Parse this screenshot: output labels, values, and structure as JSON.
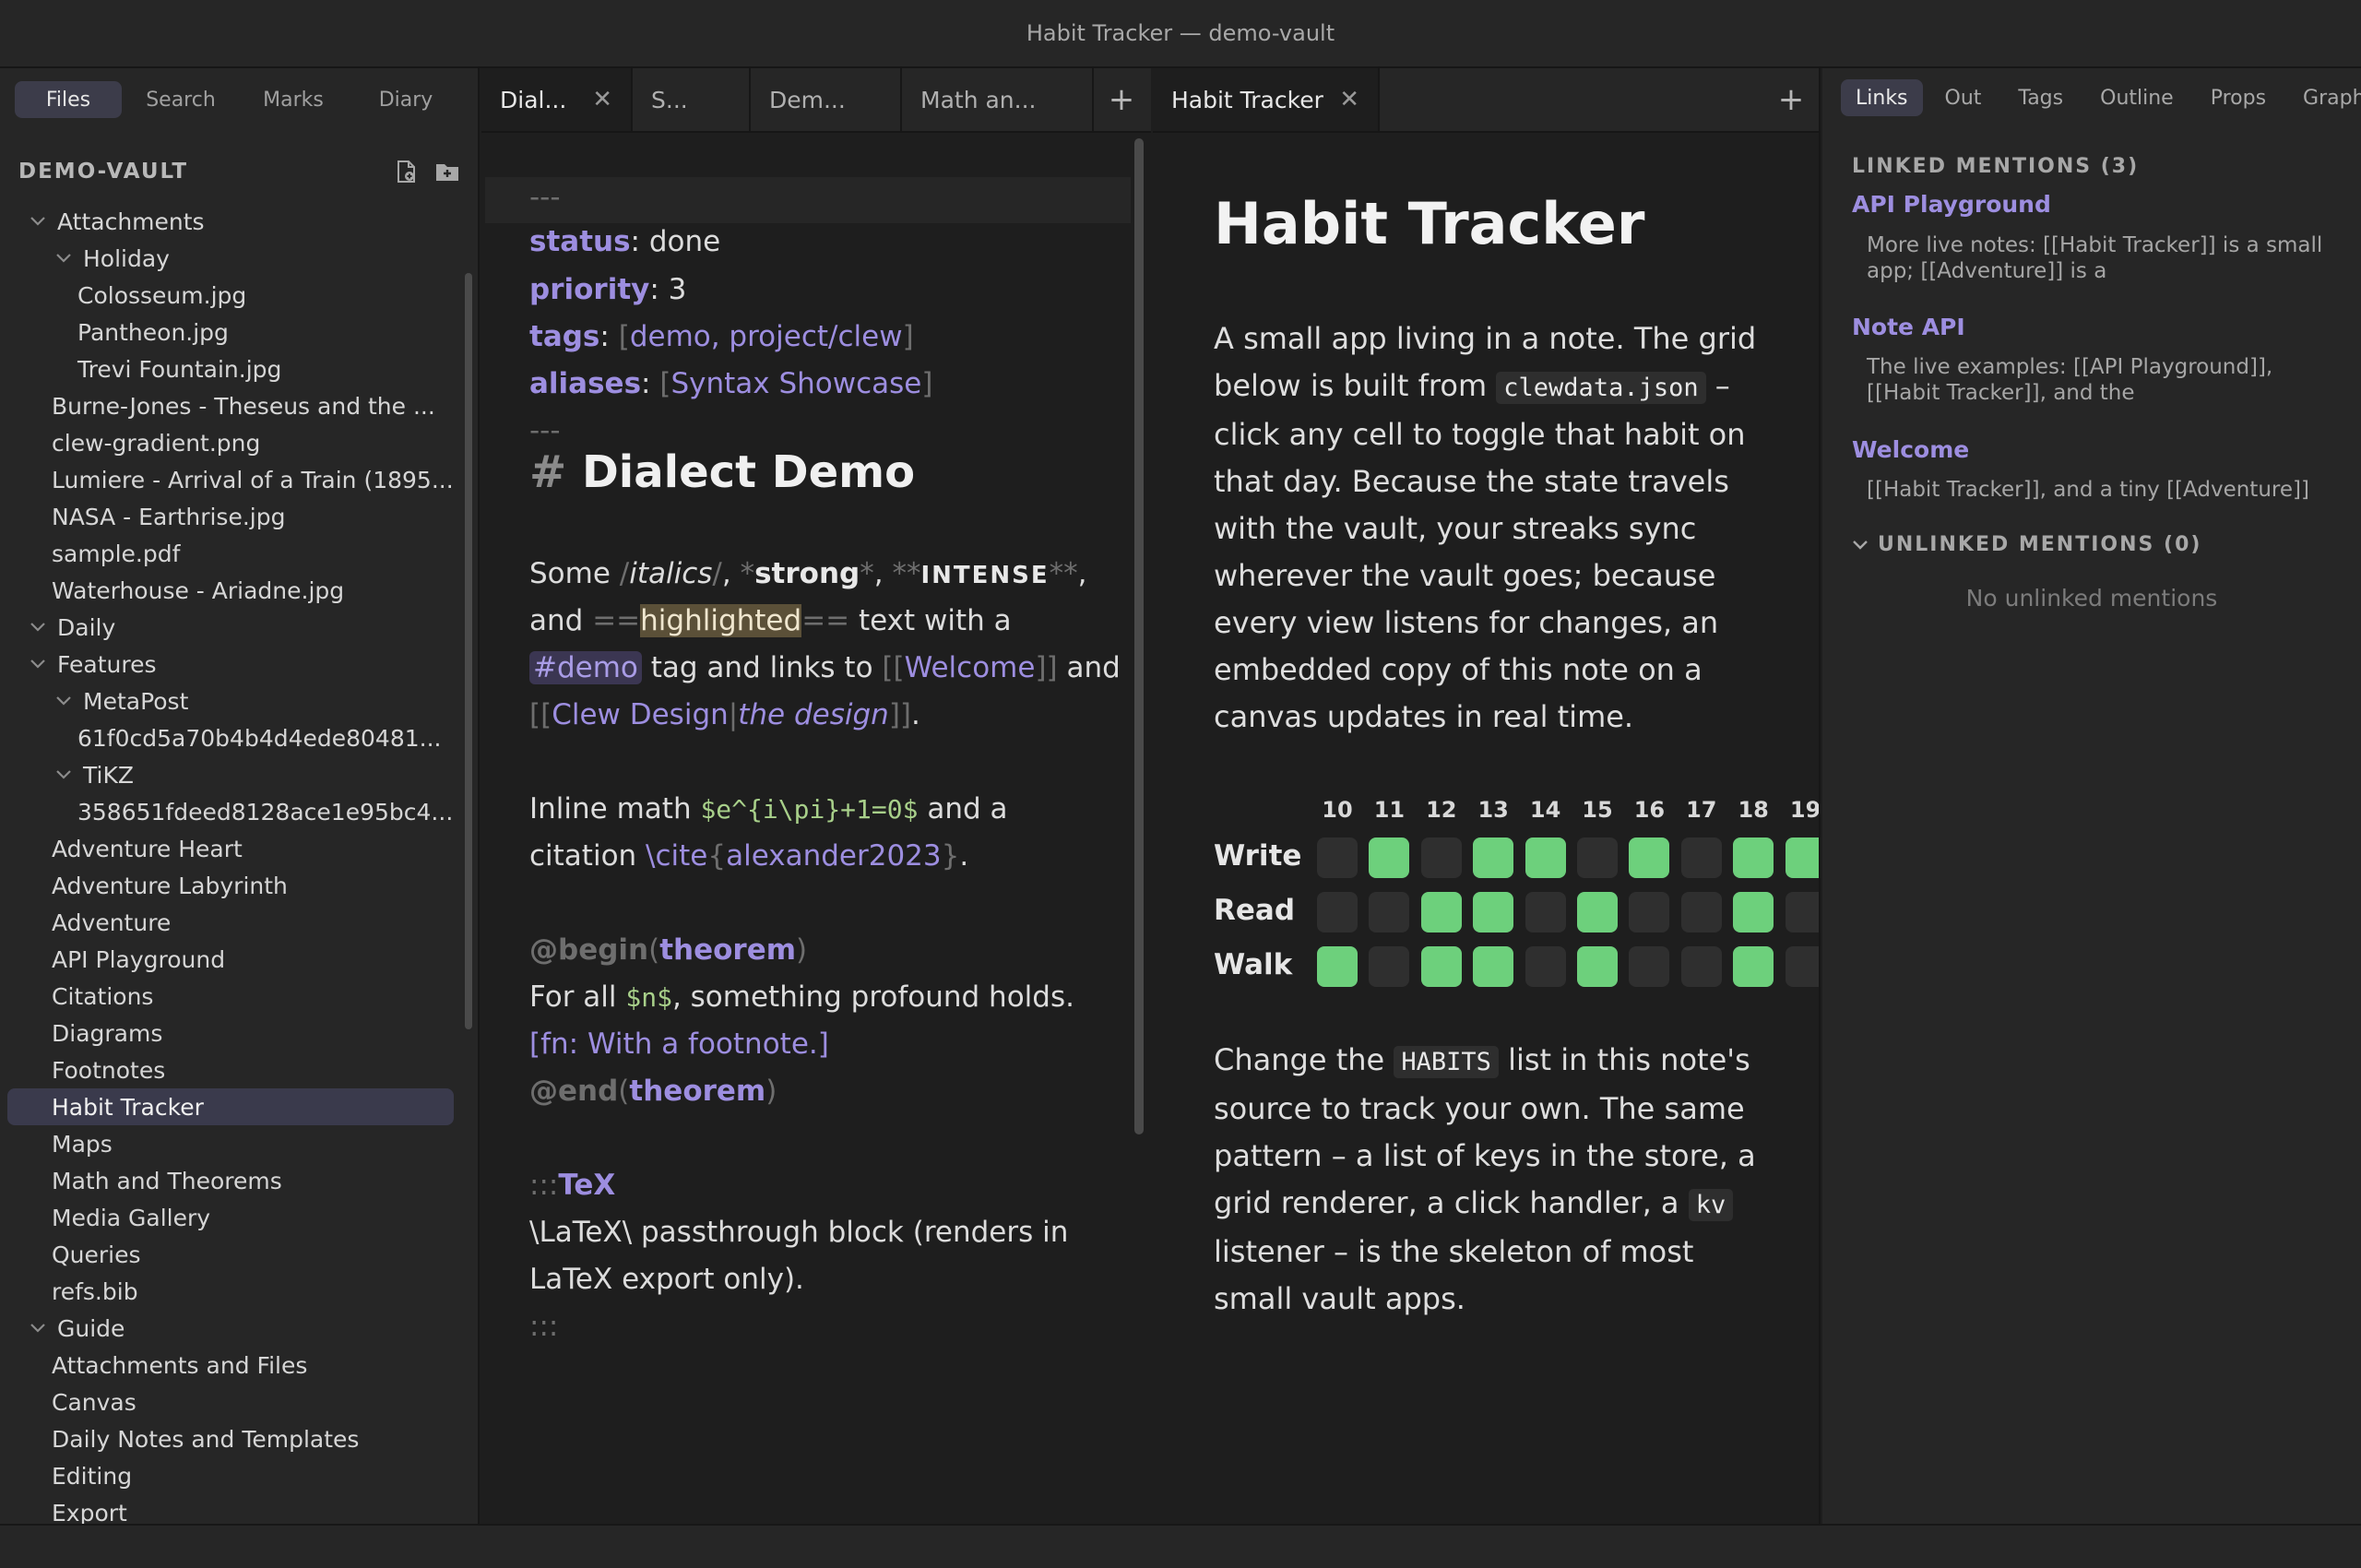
{
  "window": {
    "title": "Habit Tracker — demo-vault"
  },
  "sidebar": {
    "tabs": [
      "Files",
      "Search",
      "Marks",
      "Diary"
    ],
    "vault_name": "DEMO-VAULT",
    "tree": [
      {
        "label": "Attachments",
        "depth": 0,
        "folder": true
      },
      {
        "label": "Holiday",
        "depth": 1,
        "folder": true
      },
      {
        "label": "Colosseum.jpg",
        "depth": 2
      },
      {
        "label": "Pantheon.jpg",
        "depth": 2
      },
      {
        "label": "Trevi Fountain.jpg",
        "depth": 2
      },
      {
        "label": "Burne-Jones - Theseus and the ...",
        "depth": 1
      },
      {
        "label": "clew-gradient.png",
        "depth": 1
      },
      {
        "label": "Lumiere - Arrival of a Train (1895...",
        "depth": 1
      },
      {
        "label": "NASA - Earthrise.jpg",
        "depth": 1
      },
      {
        "label": "sample.pdf",
        "depth": 1
      },
      {
        "label": "Waterhouse - Ariadne.jpg",
        "depth": 1
      },
      {
        "label": "Daily",
        "depth": 0,
        "folder": true
      },
      {
        "label": "Features",
        "depth": 0,
        "folder": true
      },
      {
        "label": "MetaPost",
        "depth": 1,
        "folder": true
      },
      {
        "label": "61f0cd5a70b4b4d4ede80481...",
        "depth": 2
      },
      {
        "label": "TiKZ",
        "depth": 1,
        "folder": true
      },
      {
        "label": "358651fdeed8128ace1e95bc4...",
        "depth": 2
      },
      {
        "label": "Adventure Heart",
        "depth": 1
      },
      {
        "label": "Adventure Labyrinth",
        "depth": 1
      },
      {
        "label": "Adventure",
        "depth": 1
      },
      {
        "label": "API Playground",
        "depth": 1
      },
      {
        "label": "Citations",
        "depth": 1
      },
      {
        "label": "Diagrams",
        "depth": 1
      },
      {
        "label": "Footnotes",
        "depth": 1
      },
      {
        "label": "Habit Tracker",
        "depth": 1,
        "active": true
      },
      {
        "label": "Maps",
        "depth": 1
      },
      {
        "label": "Math and Theorems",
        "depth": 1
      },
      {
        "label": "Media Gallery",
        "depth": 1
      },
      {
        "label": "Queries",
        "depth": 1
      },
      {
        "label": "refs.bib",
        "depth": 1
      },
      {
        "label": "Guide",
        "depth": 0,
        "folder": true
      },
      {
        "label": "Attachments and Files",
        "depth": 1
      },
      {
        "label": "Canvas",
        "depth": 1
      },
      {
        "label": "Daily Notes and Templates",
        "depth": 1
      },
      {
        "label": "Editing",
        "depth": 1
      },
      {
        "label": "Export",
        "depth": 1
      }
    ]
  },
  "editor": {
    "tabs": [
      {
        "label": "Dial...",
        "active": true,
        "closable": true
      },
      {
        "label": "S..."
      },
      {
        "label": "Dem..."
      },
      {
        "label": "Math an..."
      }
    ],
    "frontmatter": {
      "fence": "---",
      "status_key": "status",
      "status_val": "done",
      "priority_key": "priority",
      "priority_val": "3",
      "tags_key": "tags",
      "tags_val": "demo, project/clew",
      "aliases_key": "aliases",
      "aliases_val": "Syntax Showcase"
    },
    "heading_mark": "#",
    "heading": "Dialect Demo",
    "p1": {
      "some": "Some ",
      "slash": "/",
      "italics": "italics",
      "comma1": ", ",
      "star": "*",
      "strong": "strong",
      "comma2": ", ",
      "dstar": "**",
      "intense": "INTENSE",
      "comma3": ",",
      "and": "and ",
      "eq": "==",
      "highlighted": "highlighted",
      "textwith": " text with a",
      "tag": "#demo",
      "tagandlinks": " tag and links to ",
      "lb": "[[",
      "welcome": "Welcome",
      "rb": "]]",
      "and2": " and",
      "clew": "Clew Design",
      "pipe": "|",
      "thedesign": "the design",
      "period": "."
    },
    "p2": {
      "inline": "Inline math ",
      "math": "$e^{i\\pi}+1=0$",
      "anda": " and a",
      "citation": "citation ",
      "cite_cmd": "\\cite",
      "lbrace": "{",
      "cite_key": "alexander2023",
      "rbrace": "}",
      "period": "."
    },
    "theorem": {
      "begin": "@begin",
      "lp": "(",
      "name": "theorem",
      "rp": ")",
      "forall": "For all ",
      "n": "$n$",
      "holds": ", something profound holds.",
      "fn": "[fn: With a footnote.]",
      "end": "@end"
    },
    "tex": {
      "open": ":::",
      "name": "TeX",
      "line1": "\\LaTeX\\ passthrough block (renders in",
      "line2": "LaTeX export only).",
      "close": ":::"
    }
  },
  "preview": {
    "tab_label": "Habit Tracker",
    "title": "Habit Tracker",
    "p1": {
      "a": "A small app living in a note. The grid below is built from ",
      "code": "clewdata.json",
      "b": " – click any cell to toggle that habit on that day. Because the state travels with the vault, your streaks sync wherever the vault goes; because every view listens for changes, an embedded copy of this note on a canvas updates in real time."
    },
    "grid": {
      "days": [
        "10",
        "11",
        "12",
        "13",
        "14",
        "15",
        "16",
        "17",
        "18",
        "19"
      ],
      "habits": [
        {
          "name": "Write",
          "done": [
            false,
            true,
            false,
            true,
            true,
            false,
            true,
            false,
            true,
            true
          ]
        },
        {
          "name": "Read",
          "done": [
            false,
            false,
            true,
            true,
            false,
            true,
            false,
            false,
            true,
            false
          ]
        },
        {
          "name": "Walk",
          "done": [
            true,
            false,
            true,
            true,
            false,
            true,
            false,
            false,
            true,
            false
          ]
        }
      ],
      "on_color": "#6dd07c",
      "off_color": "#2f2f2f"
    },
    "p2": {
      "a": "Change the ",
      "code1": "HABITS",
      "b": " list in this note's source to track your own. The same pattern – a list of keys in the store, a grid renderer, a click handler, a ",
      "code2": "kv",
      "c": " listener – is the skeleton of most small vault apps."
    }
  },
  "right_panel": {
    "tabs": [
      "Links",
      "Out",
      "Tags",
      "Outline",
      "Props",
      "Graph"
    ],
    "linked_header": "LINKED MENTIONS (3)",
    "mentions": [
      {
        "title": "API Playground",
        "snippet": "More live notes: [[Habit Tracker]] is a small app; [[Adventure]] is a"
      },
      {
        "title": "Note API",
        "snippet": "The live examples: [[API Playground]], [[Habit Tracker]], and the"
      },
      {
        "title": "Welcome",
        "snippet": "[[Habit Tracker]], and a tiny [[Adventure]]"
      }
    ],
    "unlinked_header": "UNLINKED MENTIONS (0)",
    "unlinked_empty": "No unlinked mentions"
  },
  "colors": {
    "accent": "#9d8ee0",
    "highlight": "#5b5038",
    "habit_on": "#6dd07c"
  }
}
